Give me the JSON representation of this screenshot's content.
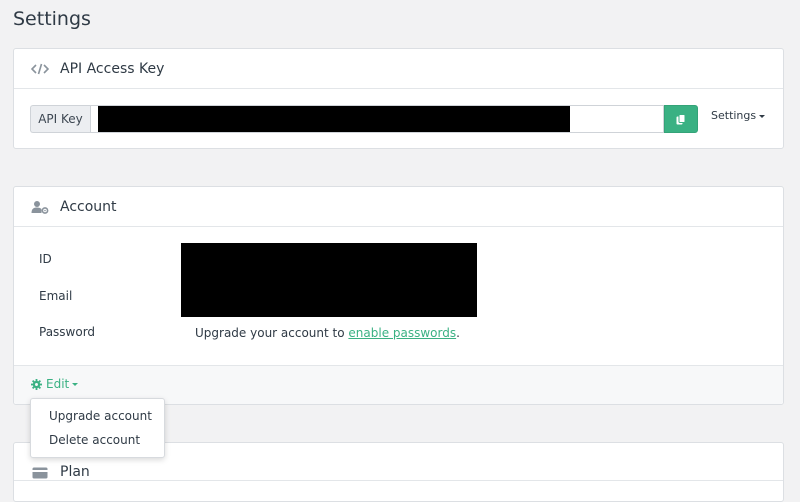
{
  "page": {
    "title": "Settings"
  },
  "api_card": {
    "title": "API Access Key",
    "icon": "code-icon",
    "key_label": "API Key",
    "settings_label": "Settings"
  },
  "account_card": {
    "title": "Account",
    "icon": "user-gear-icon",
    "fields": {
      "id_label": "ID",
      "email_label": "Email",
      "password_label": "Password"
    },
    "password_text": "Upgrade your account to ",
    "password_link": "enable passwords",
    "password_suffix": ".",
    "edit_label": "Edit"
  },
  "dropdown": {
    "items": [
      "Upgrade account",
      "Delete account"
    ]
  },
  "plan_card": {
    "title": "Plan",
    "icon": "card-icon"
  },
  "colors": {
    "accent": "#3ab183",
    "text": "#2f3a45",
    "background": "#f2f2f3"
  }
}
